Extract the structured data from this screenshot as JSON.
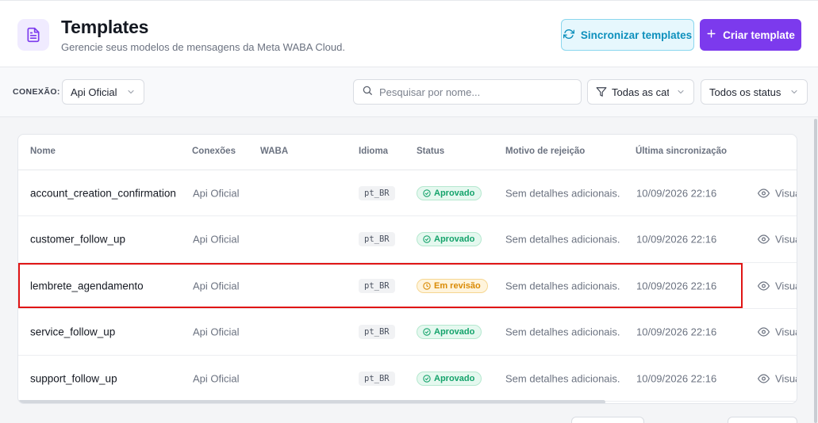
{
  "header": {
    "title": "Templates",
    "subtitle": "Gerencie seus modelos de mensagens da Meta WABA Cloud.",
    "sync_label": "Sincronizar templates",
    "create_label": "Criar template"
  },
  "filters": {
    "connection_label": "CONEXÃO:",
    "connection_value": "Api Oficial",
    "search_placeholder": "Pesquisar por nome...",
    "category_value": "Todas as categorias",
    "status_value": "Todos os status"
  },
  "table": {
    "columns": [
      "Nome",
      "Conexões",
      "WABA",
      "Idioma",
      "Status",
      "Motivo de rejeição",
      "Última sincronização"
    ],
    "view_label": "Visualizar",
    "rows": [
      {
        "name": "account_creation_confirmation",
        "connection": "Api Oficial",
        "language": "pt_BR",
        "status": "Aprovado",
        "status_kind": "ok",
        "reason": "Sem detalhes adicionais.",
        "synced": "10/09/2026 22:16"
      },
      {
        "name": "customer_follow_up",
        "connection": "Api Oficial",
        "language": "pt_BR",
        "status": "Aprovado",
        "status_kind": "ok",
        "reason": "Sem detalhes adicionais.",
        "synced": "10/09/2026 22:16"
      },
      {
        "name": "lembrete_agendamento",
        "connection": "Api Oficial",
        "language": "pt_BR",
        "status": "Em revisão",
        "status_kind": "rev",
        "reason": "Sem detalhes adicionais.",
        "synced": "10/09/2026 22:16"
      },
      {
        "name": "service_follow_up",
        "connection": "Api Oficial",
        "language": "pt_BR",
        "status": "Aprovado",
        "status_kind": "ok",
        "reason": "Sem detalhes adicionais.",
        "synced": "10/09/2026 22:16"
      },
      {
        "name": "support_follow_up",
        "connection": "Api Oficial",
        "language": "pt_BR",
        "status": "Aprovado",
        "status_kind": "ok",
        "reason": "Sem detalhes adicionais.",
        "synced": "10/09/2026 22:16"
      }
    ]
  },
  "colors": {
    "accent": "#7c3aed",
    "sync_button": "#0e90bd",
    "approved": "#14a36b",
    "in_review": "#d98a04",
    "highlight": "#e01515"
  }
}
